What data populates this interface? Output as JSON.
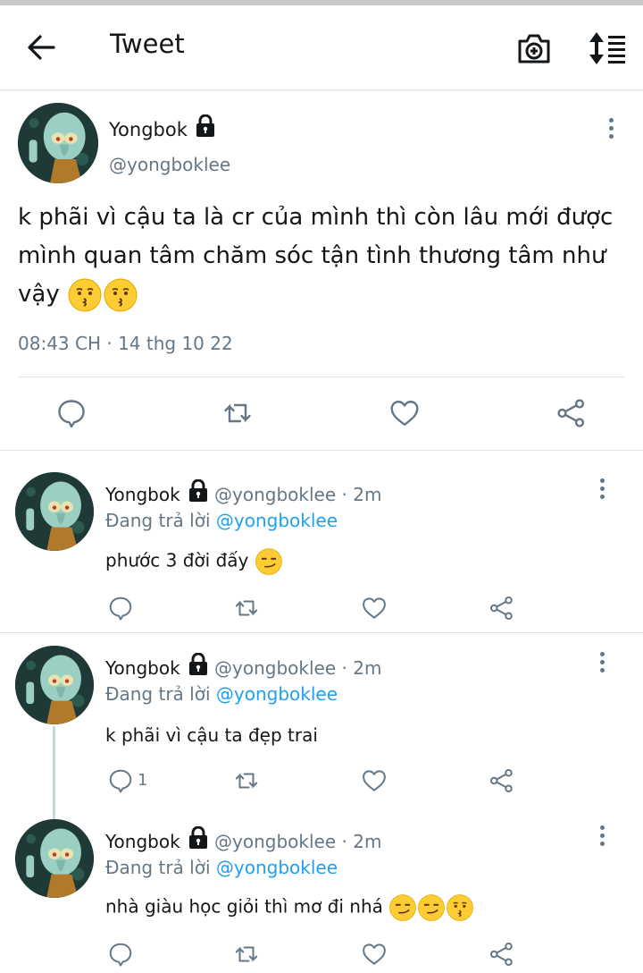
{
  "header": {
    "title": "Tweet",
    "back_icon": "arrow-left-icon",
    "camera_icon": "camera-plus-icon",
    "sort_icon": "sort-icon"
  },
  "main_tweet": {
    "name": "Yongbok",
    "handle": "@yongboklee",
    "text": "k phãi vì cậu ta là cr của mình thì còn lâu mới được mình quan tâm chăm sóc tận tình thương tâm như vậy",
    "emojis": [
      "kissing-face",
      "kissing-face"
    ],
    "timestamp": "08:43 CH · 14 thg 10 22"
  },
  "replies": [
    {
      "name": "Yongbok",
      "handle": "@yongboklee · 2m",
      "reply_prefix": "Đang trả lời",
      "reply_to": "@yongboklee",
      "text": "phước 3 đời đấy",
      "emojis": [
        "smirking-face"
      ],
      "reply_count": ""
    },
    {
      "name": "Yongbok",
      "handle": "@yongboklee · 2m",
      "reply_prefix": "Đang trả lời",
      "reply_to": "@yongboklee",
      "text": "k phãi vì cậu ta đẹp trai",
      "emojis": [],
      "reply_count": "1"
    },
    {
      "name": "Yongbok",
      "handle": "@yongboklee · 2m",
      "reply_prefix": "Đang trả lời",
      "reply_to": "@yongboklee",
      "text": "nhà giàu học giỏi thì mơ đi nhá",
      "emojis": [
        "smirking-face",
        "smirking-face",
        "kissing-face"
      ],
      "reply_count": ""
    }
  ],
  "colors": {
    "link": "#1da1f2",
    "secondary": "#657786",
    "text": "#14171a"
  }
}
